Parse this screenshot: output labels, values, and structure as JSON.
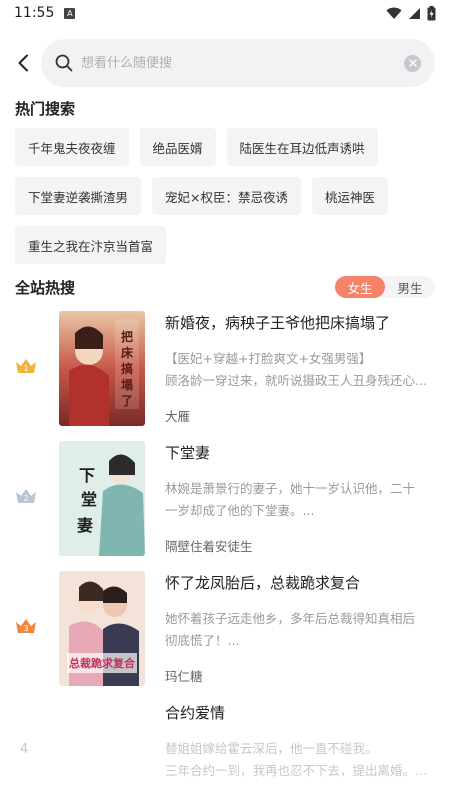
{
  "status_bar": {
    "time": "11:55",
    "notif": "A"
  },
  "search": {
    "placeholder": "想看什么随便搜"
  },
  "hot_search": {
    "title": "热门搜索",
    "tags": [
      "千年鬼夫夜夜缠",
      "绝品医婿",
      "陆医生在耳边低声诱哄",
      "下堂妻逆袭撕渣男",
      "宠妃×权臣：禁忌夜诱",
      "桃运神医",
      "重生之我在汴京当首富"
    ]
  },
  "site_hot": {
    "title": "全站热搜",
    "gender_female": "女生",
    "gender_male": "男生"
  },
  "books": [
    {
      "rank": "1",
      "title": "新婚夜，病秧子王爷他把床搞塌了",
      "desc_line1": "【医妃+穿越+打脸爽文+女强男强】",
      "desc_line2": "顾洛龄一穿过来，就听说摄政王人丑身残还心...",
      "author": "大雁",
      "cover_text": "把床搞塌了"
    },
    {
      "rank": "2",
      "title": "下堂妻",
      "desc_line1": "林婉是萧景行的妻子，她十一岁认识他，二十",
      "desc_line2": "一岁却成了他的下堂妻。...",
      "author": "隔壁住着安徒生",
      "cover_text": "下堂妻"
    },
    {
      "rank": "3",
      "title": "怀了龙凤胎后，总裁跪求复合",
      "desc_line1": "她怀着孩子远走他乡，多年后总裁得知真相后",
      "desc_line2": "彻底慌了！...",
      "author": "玛仁糖",
      "cover_text": "总裁跪求复合"
    },
    {
      "rank": "4",
      "title": "合约爱情",
      "desc_line1": "替姐姐嫁给霍云深后，他一直不碰我。",
      "desc_line2": "三年合约一到，我再也忍不下去，提出离婚。...",
      "author": "",
      "cover_text": ""
    }
  ],
  "colors": {
    "accent": "#f4836a",
    "gold": "#f2b33d",
    "silver": "#b9c6d3",
    "bronze": "#f0883e"
  }
}
